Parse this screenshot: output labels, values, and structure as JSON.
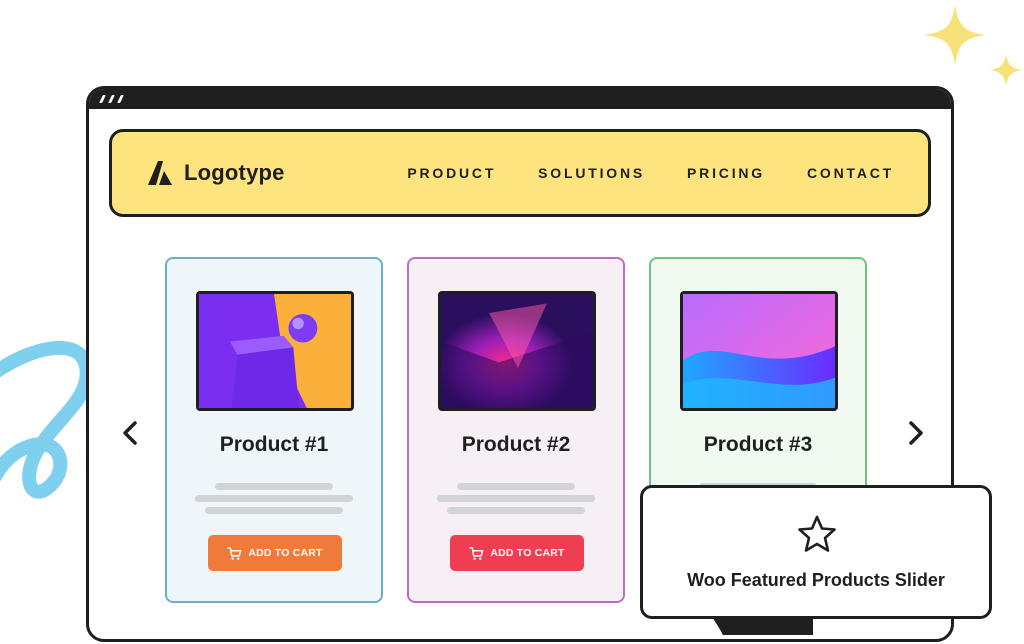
{
  "brand": {
    "name": "Logotype"
  },
  "nav": {
    "items": [
      "PRODUCT",
      "SOLUTIONS",
      "PRICING",
      "CONTACT"
    ]
  },
  "products": [
    {
      "title": "Product #1",
      "button": "ADD TO CART",
      "button_color": "#f07a3a",
      "card_border": "#6aaec9"
    },
    {
      "title": "Product #2",
      "button": "ADD TO CART",
      "button_color": "#ef3d51",
      "card_border": "#be6cc2"
    },
    {
      "title": "Product #3",
      "card_border": "#6cc57a"
    }
  ],
  "callout": {
    "label": "Woo Featured Products Slider",
    "icon": "star-icon"
  },
  "colors": {
    "navbar_bg": "#fde47e",
    "frame": "#1f1f1f",
    "sparkle": "#f7e27a",
    "scribble": "#7fd0ee"
  }
}
